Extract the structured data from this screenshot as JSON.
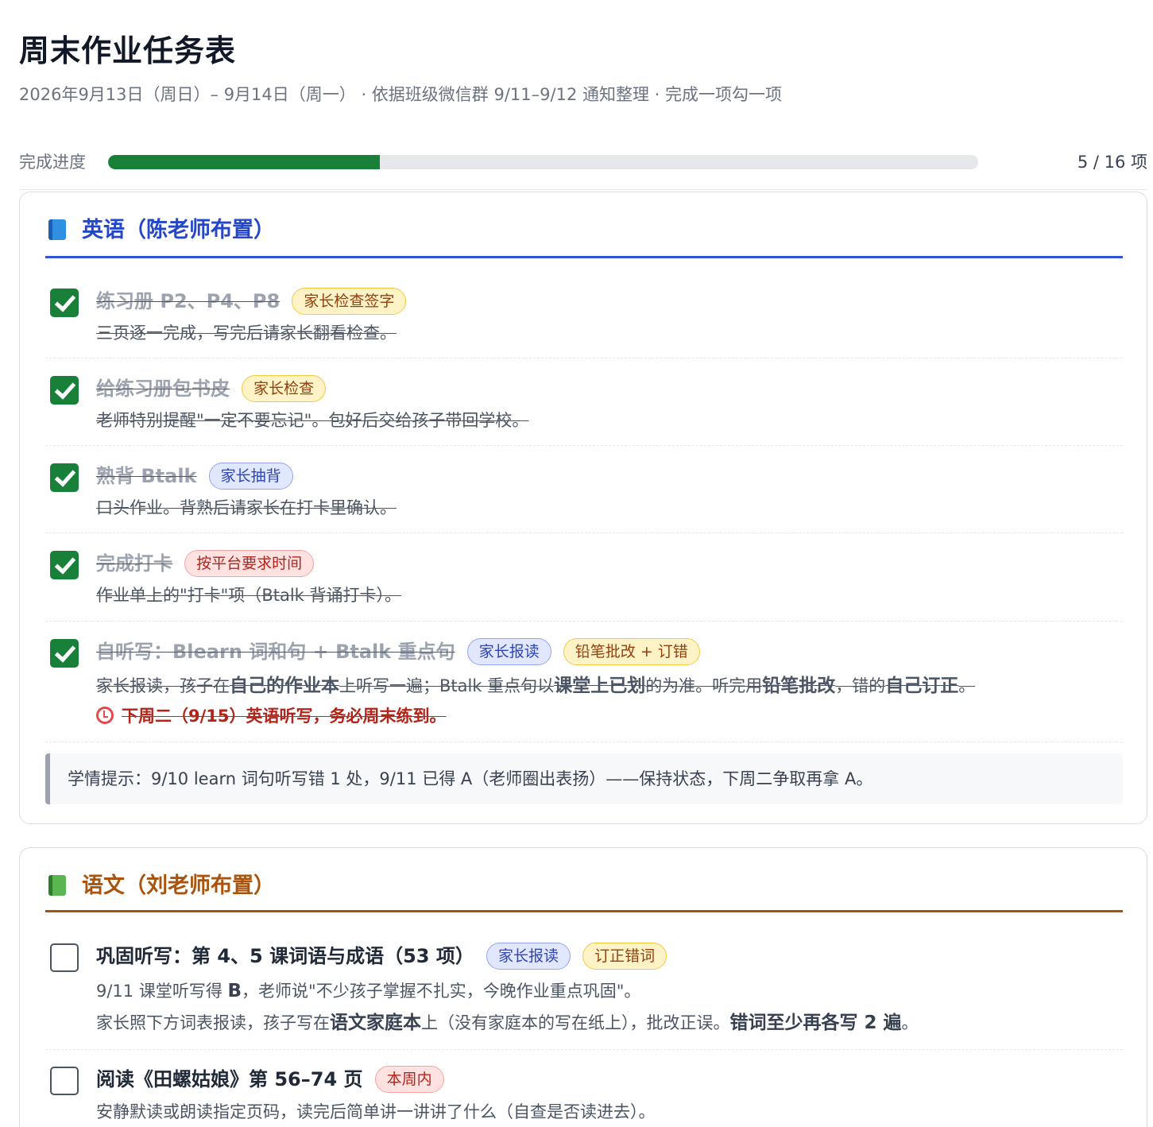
{
  "header": {
    "title": "周末作业任务表",
    "subtitle": "2026年9月13日（周日）– 9月14日（周一） · 依据班级微信群 9/11–9/12 通知整理 · 完成一项勾一项"
  },
  "progress": {
    "label": "完成进度",
    "done": 5,
    "total": 16,
    "fraction": 0.3125,
    "count_text": "5 / 16 项",
    "fill_color": "#188038"
  },
  "english": {
    "title": "英语（陈老师布置）",
    "icon": "blue-book-icon",
    "accent": "#2447c9",
    "tasks": [
      {
        "checked": true,
        "title": "练习册 P2、P4、P8",
        "tags": [
          "家长检查签字"
        ],
        "desc": "三页逐一完成，写完后请家长翻看检查。"
      },
      {
        "checked": true,
        "title": "给练习册包书皮",
        "tags": [
          "家长检查"
        ],
        "desc": "老师特别提醒\"一定不要忘记\"。包好后交给孩子带回学校。"
      },
      {
        "checked": true,
        "title": "熟背 Btalk",
        "tags": [
          "家长抽背"
        ],
        "desc": "口头作业。背熟后请家长在打卡里确认。"
      },
      {
        "checked": true,
        "title": "完成打卡",
        "tags": [
          "按平台要求时间"
        ],
        "desc": "作业单上的\"打卡\"项（Btalk 背诵打卡）。"
      },
      {
        "checked": true,
        "title": "自听写：Blearn 词和句 + Btalk 重点句",
        "tags": [
          "家长报读",
          "铅笔批改 + 订错"
        ],
        "desc_parts": [
          "家长报读，孩子在",
          "自己的作业本",
          "上听写一遍；Btalk 重点句以",
          "课堂上已划",
          "的为准。听完用",
          "铅笔批改",
          "，错的",
          "自己订正",
          "。"
        ],
        "alert": "下周二（9/15）英语听写，务必周末练到。"
      }
    ],
    "hint": "学情提示：9/10 learn 词句听写错 1 处，9/11 已得 A（老师圈出表扬）——保持状态，下周二争取再拿 A。"
  },
  "chinese": {
    "title": "语文（刘老师布置）",
    "icon": "green-book-icon",
    "accent": "#a9530c",
    "tasks": [
      {
        "checked": false,
        "title": "巩固听写：第 4、5 课词语与成语（53 项）",
        "tags": [
          "家长报读",
          "订正错词"
        ],
        "line1_parts": [
          "9/11 课堂听写得 ",
          "B",
          "，老师说\"不少孩子掌握不扎实，今晚作业重点巩固\"。"
        ],
        "line2_parts": [
          "家长照下方词表报读，孩子写在",
          "语文家庭本",
          "上（没有家庭本的写在纸上），批改正误。",
          "错词至少再各写 2 遍",
          "。"
        ]
      },
      {
        "checked": false,
        "title": "阅读《田螺姑娘》第 56–74 页",
        "tags": [
          "本周内"
        ],
        "desc": "安静默读或朗读指定页码，读完后简单讲一讲讲了什么（自查是否读进去）。"
      }
    ]
  }
}
